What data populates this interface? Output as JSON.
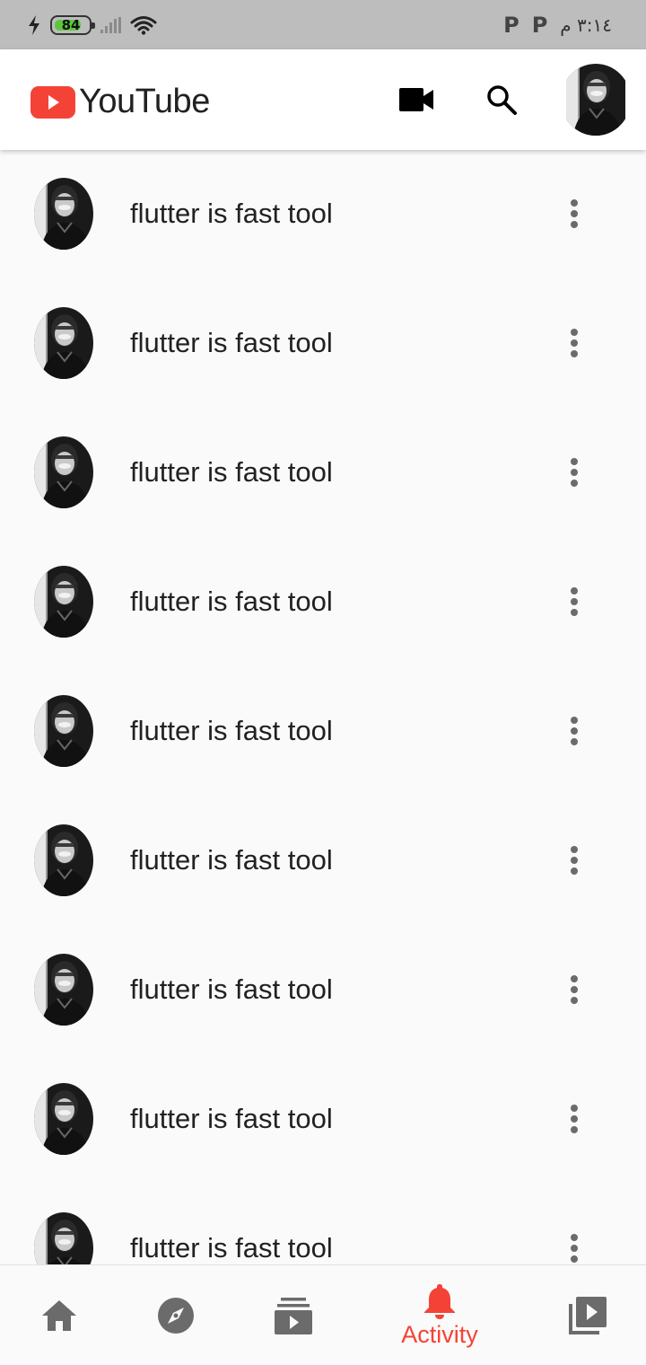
{
  "status_bar": {
    "battery": "84",
    "battery_level_percent": 84,
    "notification_glyph_1": "P",
    "notification_glyph_2": "P",
    "time": "٣:١٤ م"
  },
  "app_bar": {
    "logo_text": "YouTube",
    "brand_color": "#f44336",
    "icons": [
      "video-camera-icon",
      "search-icon",
      "profile-avatar"
    ]
  },
  "notifications": [
    {
      "title": "flutter is fast tool"
    },
    {
      "title": "flutter is fast tool"
    },
    {
      "title": "flutter is fast tool"
    },
    {
      "title": "flutter is fast tool"
    },
    {
      "title": "flutter is fast tool"
    },
    {
      "title": "flutter is fast tool"
    },
    {
      "title": "flutter is fast tool"
    },
    {
      "title": "flutter is fast tool"
    },
    {
      "title": "flutter is fast tool"
    }
  ],
  "bottom_nav": {
    "items": [
      {
        "icon": "home-icon",
        "label": ""
      },
      {
        "icon": "explore-icon",
        "label": ""
      },
      {
        "icon": "subscriptions-icon",
        "label": ""
      },
      {
        "icon": "bell-icon",
        "label": "Activity",
        "active": true
      },
      {
        "icon": "library-icon",
        "label": ""
      }
    ],
    "active_color": "#f44336",
    "inactive_color": "#6b6b6b"
  }
}
